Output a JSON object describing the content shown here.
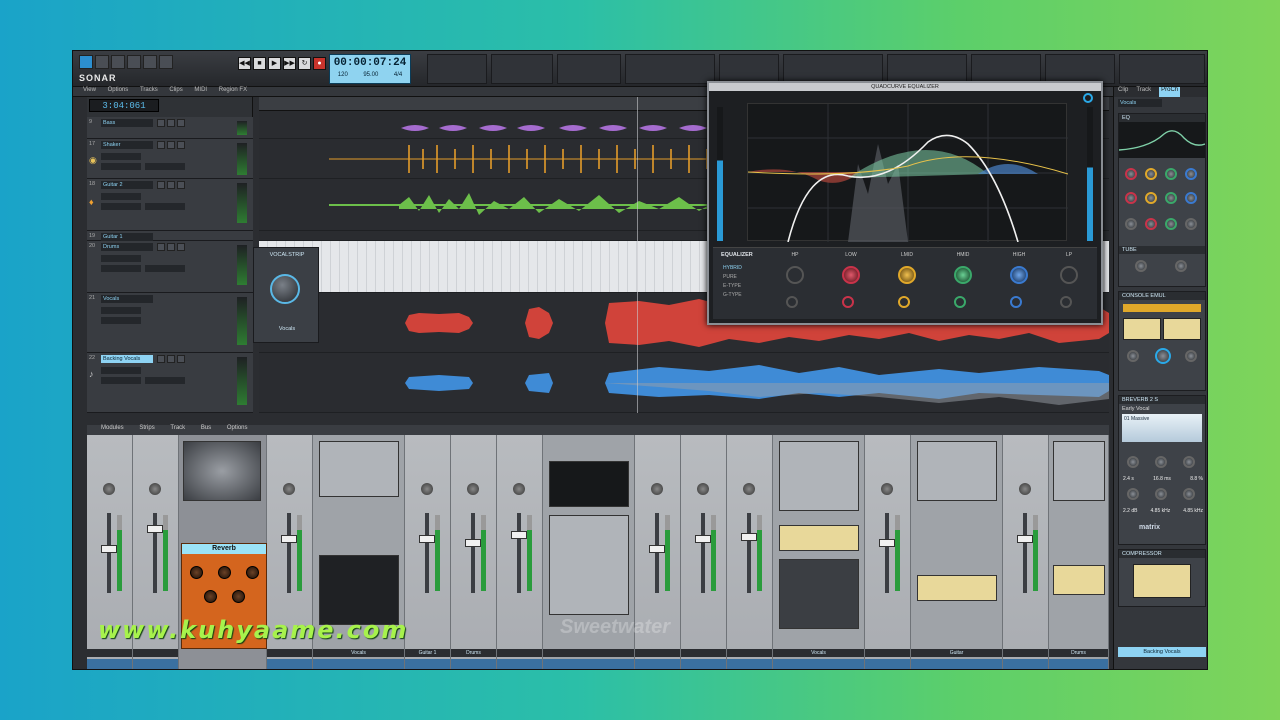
{
  "app": {
    "logo": "SONAR",
    "time": "00:00:07:24",
    "time_sub": [
      "120",
      "95.00",
      "4/4"
    ],
    "big_time": "3:04:061"
  },
  "menu": {
    "items": [
      "View",
      "Options",
      "Tracks",
      "Clips",
      "MIDI",
      "Region FX"
    ]
  },
  "tracks": [
    {
      "num": "9",
      "name": "Bass"
    },
    {
      "num": "17",
      "name": "Shaker"
    },
    {
      "num": "18",
      "name": "Guitar 2"
    },
    {
      "num": "19",
      "name": "Guitar 1"
    },
    {
      "num": "20",
      "name": "Drums"
    },
    {
      "num": "21",
      "name": "Vocals"
    },
    {
      "num": "22",
      "name": "Backing Vocals"
    }
  ],
  "prochannel": {
    "title": "VOCALSTRIP",
    "label": "Vocals"
  },
  "eq": {
    "title": "QUADCURVE EQUALIZER",
    "section_label": "EQUALIZER",
    "modes": [
      "HYBRID",
      "PURE",
      "E-TYPE",
      "G-TYPE"
    ],
    "band_tags": [
      "HP",
      "LOW",
      "LMID",
      "HMID",
      "HIGH",
      "LP"
    ]
  },
  "console": {
    "menu": [
      "Modules",
      "Strips",
      "Track",
      "Bus",
      "Options"
    ]
  },
  "strip_labels": [
    "Vocals",
    "Guitar 1",
    "Drums",
    "Vocals",
    "Guitar",
    "Drums"
  ],
  "reverb": {
    "title": "Reverb"
  },
  "rpanel": {
    "tabs": [
      "Clip",
      "Track",
      "ProCh"
    ],
    "active_tab": "ProCh",
    "track_name": "Vocals",
    "eq_module": "EQ",
    "tube": "TUBE",
    "console": "CONSOLE EMUL",
    "comp": "CONSOLE",
    "matrix": "BREVERB 2 S",
    "matrix_label": "Early Vocal",
    "preset_value": "01 Massive",
    "values": [
      "2.4 s",
      "16.8 ms",
      "8.8 %",
      "2.2 dB",
      "4.85 kHz",
      "4.85 kHz"
    ],
    "bottom_module": "COMPRESSOR",
    "footer": "Backing Vocals",
    "product": "matrix"
  },
  "watermark": "www.kuhyaame.com",
  "brand": "Sweetwater",
  "colors": {
    "accent": "#8ed3f3",
    "vocals_wave": "#d0433a",
    "backing_wave": "#3f8bd6",
    "guitar_wave": "#6cbf4a",
    "shaker_wave": "#e39c2a",
    "bass_wave": "#a56ccf"
  }
}
